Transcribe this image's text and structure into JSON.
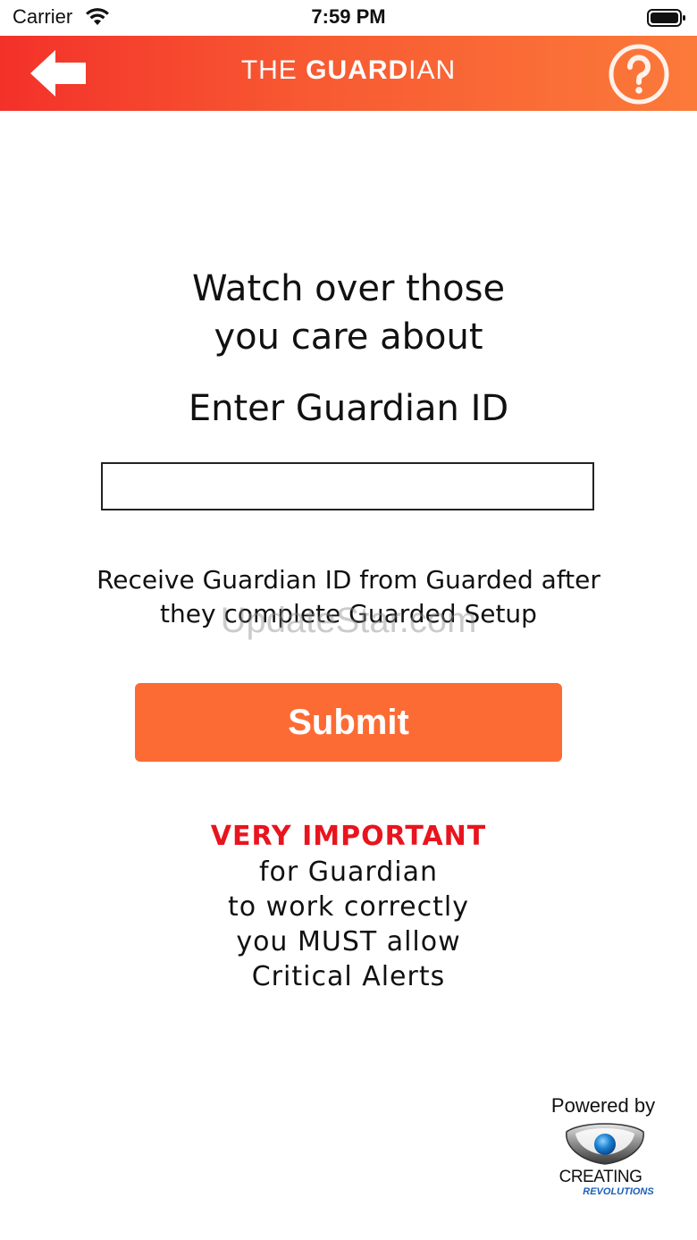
{
  "status_bar": {
    "carrier": "Carrier",
    "time": "7:59 PM"
  },
  "header": {
    "brand_light": "THE ",
    "brand_bold": "GUARD",
    "brand_tail": "IAN",
    "back_icon": "arrow-left-icon",
    "help_icon": "question-circle-icon",
    "gradient": [
      "#f3312a",
      "#fb7a3a"
    ]
  },
  "main": {
    "headline_line1": "Watch over those",
    "headline_line2": "you care about",
    "prompt": "Enter Guardian ID",
    "input_value": "",
    "hint_line1": "Receive Guardian ID from Guarded after",
    "hint_line2": "they complete Guarded Setup",
    "submit_label": "Submit",
    "submit_color": "#fd6b34"
  },
  "notice": {
    "title": "VERY IMPORTANT",
    "line1": "for Guardian",
    "line2": "to work correctly",
    "line3": "you MUST allow",
    "line4": "Critical Alerts",
    "title_color": "#e8141e"
  },
  "watermark": "UpdateStar.com",
  "footer": {
    "powered_by": "Powered by",
    "logo_line1": "CREATING",
    "logo_line2": "REVOLUTIONS"
  }
}
